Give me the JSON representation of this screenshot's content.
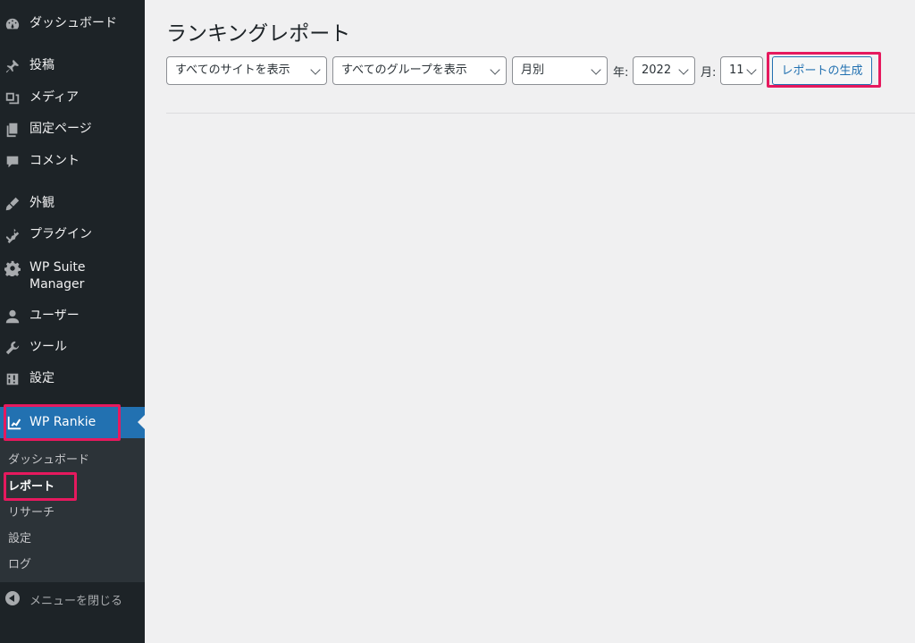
{
  "sidebar": {
    "items": [
      {
        "label": "ダッシュボード",
        "icon": "dashboard-icon"
      },
      {
        "label": "投稿",
        "icon": "pin-icon"
      },
      {
        "label": "メディア",
        "icon": "media-icon"
      },
      {
        "label": "固定ページ",
        "icon": "page-icon"
      },
      {
        "label": "コメント",
        "icon": "comment-icon"
      },
      {
        "label": "外観",
        "icon": "paintbrush-icon"
      },
      {
        "label": "プラグイン",
        "icon": "plug-icon"
      },
      {
        "label": "WP Suite Manager",
        "icon": "gear-icon"
      },
      {
        "label": "ユーザー",
        "icon": "user-icon"
      },
      {
        "label": "ツール",
        "icon": "wrench-icon"
      },
      {
        "label": "設定",
        "icon": "settings-icon"
      }
    ],
    "active": {
      "label": "WP Rankie",
      "icon": "rankie-icon"
    },
    "submenu": [
      {
        "label": "ダッシュボード"
      },
      {
        "label": "レポート"
      },
      {
        "label": "リサーチ"
      },
      {
        "label": "設定"
      },
      {
        "label": "ログ"
      }
    ],
    "collapse_label": "メニューを閉じる"
  },
  "main": {
    "title": "ランキングレポート",
    "filters": {
      "site_select": "すべてのサイトを表示",
      "group_select": "すべてのグループを表示",
      "period_select": "月別",
      "year_label": "年:",
      "year_select": "2022",
      "month_label": "月:",
      "month_select": "11"
    },
    "generate_button": "レポートの生成"
  },
  "colors": {
    "sidebar_bg": "#1d2327",
    "submenu_bg": "#2c3338",
    "accent": "#2271b1",
    "highlight": "#e6195e",
    "content_bg": "#f0f0f1"
  }
}
